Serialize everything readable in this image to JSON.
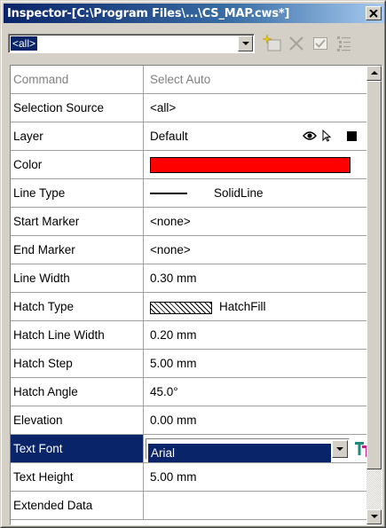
{
  "window": {
    "title": "Inspector-[C:\\Program Files\\...\\CS_MAP.cws*]"
  },
  "toolbar": {
    "selector_value": "<all>",
    "buttons": [
      {
        "name": "new-object-button",
        "icon": "sparkle-new-icon"
      },
      {
        "name": "delete-button",
        "icon": "x-icon"
      },
      {
        "name": "apply-button",
        "icon": "checkbox-icon"
      },
      {
        "name": "list-button",
        "icon": "list-icon"
      }
    ]
  },
  "properties": [
    {
      "name": "Command",
      "value": "Select Auto",
      "disabled": true
    },
    {
      "name": "Selection Source",
      "value": "<all>"
    },
    {
      "name": "Layer",
      "value": "Default"
    },
    {
      "name": "Color",
      "value": "",
      "swatch": "#ff0000"
    },
    {
      "name": "Line Type",
      "value": "SolidLine"
    },
    {
      "name": "Start Marker",
      "value": "<none>"
    },
    {
      "name": "End Marker",
      "value": "<none>"
    },
    {
      "name": "Line Width",
      "value": "0.30 mm"
    },
    {
      "name": "Hatch Type",
      "value": "HatchFill"
    },
    {
      "name": "Hatch Line Width",
      "value": "0.20 mm"
    },
    {
      "name": "Hatch Step",
      "value": "5.00 mm"
    },
    {
      "name": "Hatch Angle",
      "value": "45.0°"
    },
    {
      "name": "Elevation",
      "value": "0.00 mm"
    },
    {
      "name": "Text Font",
      "value": "Arial",
      "selected": true
    },
    {
      "name": "Text Height",
      "value": "5.00 mm"
    },
    {
      "name": "Extended Data",
      "value": ""
    }
  ],
  "colors": {
    "title_bar": "#0a246a",
    "selection": "#0a246a",
    "color_swatch": "#ff0000",
    "face": "#d4d0c8"
  }
}
